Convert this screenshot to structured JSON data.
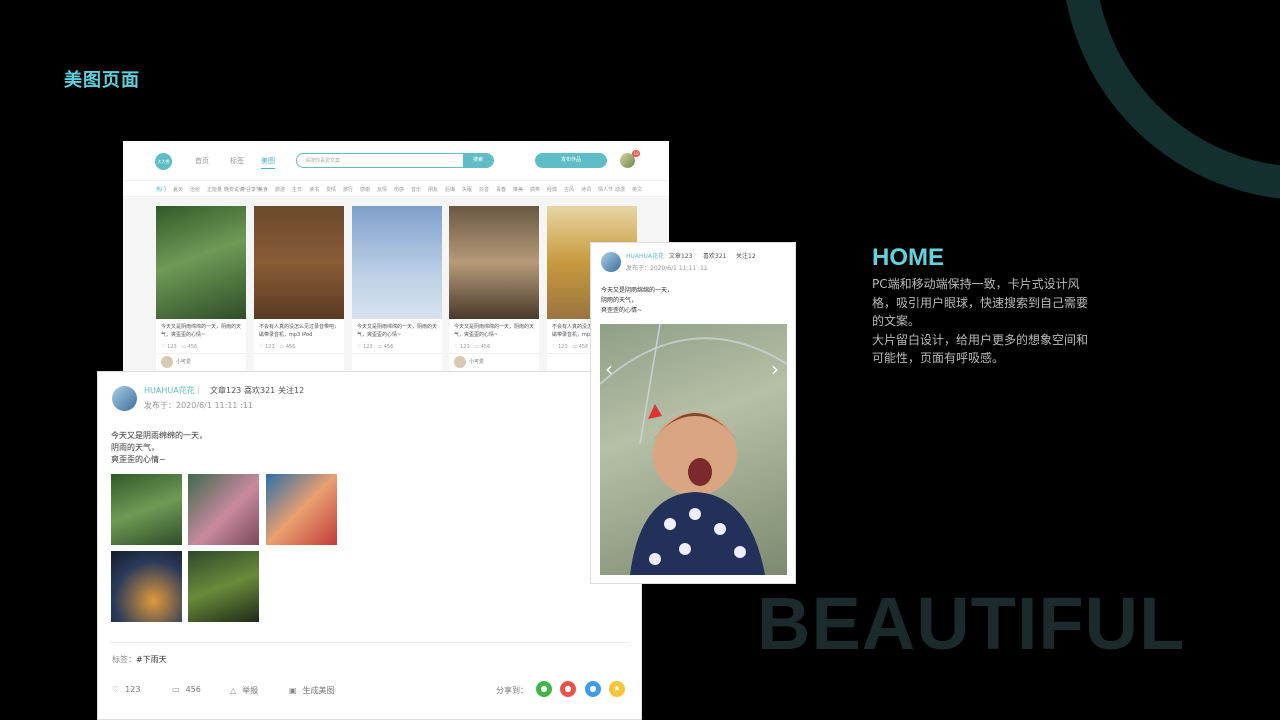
{
  "page": {
    "title": "美图页面",
    "big_word": "BEAUTIFUL",
    "home_title": "HOME",
    "home_desc": [
      "PC端和移动端保持一致，卡片式设计风格，吸引用户眼球，快速搜索到自己需要的文案。",
      "大片留白设计，给用户更多的想象空间和可能性，页面有呼吸感。"
    ]
  },
  "colors": {
    "accent": "#5fbdc8",
    "title": "#5fd0dc",
    "arc": "#14302e"
  },
  "desktop": {
    "logo": "大大雪",
    "nav": [
      "首页",
      "标签",
      "美图"
    ],
    "active_nav": "美图",
    "search_placeholder": "请搜你喜爱文案",
    "search_button": "搜索",
    "publish_button": "发布作品",
    "badge": "10",
    "categories": [
      "热门",
      "夏天",
      "治愈",
      "正能量",
      "晚安说说",
      "毕业季节",
      "美食",
      "旅游",
      "生日",
      "读书",
      "爱情",
      "旅行",
      "感谢",
      "友情",
      "伤感",
      "音乐",
      "朋友",
      "后悔",
      "失眠",
      "抖音",
      "青春",
      "唯美",
      "搞笑",
      "经典",
      "古风",
      "诗词",
      "情人节",
      "动漫",
      "英文"
    ],
    "active_category": "热门",
    "cards": [
      {
        "text": "今天又是阴雨绵绵的一天，阴雨的天气，爽歪歪的心情~",
        "likes": "123",
        "comments": "456",
        "user": "小可爱"
      },
      {
        "text": "不会有人真的没怎么见过录音带吧，磁带录音机，mp3 iPod",
        "likes": "123",
        "comments": "456",
        "user": ""
      },
      {
        "text": "今天又是阴雨绵绵的一天，阴雨的天气，爽歪歪的心情~",
        "likes": "123",
        "comments": "456",
        "user": ""
      },
      {
        "text": "今天又是阴雨绵绵的一天，阴雨的天气，爽歪歪的心情~",
        "likes": "123",
        "comments": "456",
        "user": "小可爱"
      },
      {
        "text": "不会有人真的没怎么见过录音带吧，磁带录音机，mp3",
        "likes": "123",
        "comments": "456",
        "user": ""
      }
    ]
  },
  "mobile": {
    "name": "HUAHUA花花",
    "articles": "文章123",
    "likes": "喜欢321",
    "follows": "关注12",
    "date": "发布于：2020/6/1 11:11 :11",
    "text": [
      "今天又是阴雨绵绵的一天，",
      "阴雨的天气，",
      "爽歪歪的心情~"
    ],
    "prev_icon": "‹",
    "next_icon": "›"
  },
  "post": {
    "name": "HUAHUA花花",
    "articles": "文章123",
    "likes": "喜欢321",
    "follows": "关注12",
    "date": "发布于：2020/6/1 11:11 :11",
    "text": [
      "今天又是阴雨绵绵的一天，",
      "阴雨的天气，",
      "爽歪歪的心情~"
    ],
    "tags_label": "标签：",
    "tag": "#下雨天",
    "like_count": "123",
    "comment_count": "456",
    "report": "举报",
    "generate": "生成美图",
    "share_label": "分享到："
  }
}
